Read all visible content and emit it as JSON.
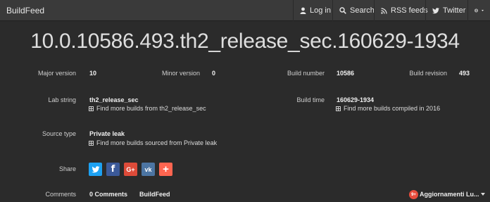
{
  "navbar": {
    "brand": "BuildFeed",
    "login": "Log in",
    "search": "Search",
    "rss": "RSS feeds",
    "twitter": "Twitter"
  },
  "build": {
    "title": "10.0.10586.493.th2_release_sec.160629-1934",
    "major_label": "Major version",
    "major_value": "10",
    "minor_label": "Minor version",
    "minor_value": "0",
    "number_label": "Build number",
    "number_value": "10586",
    "revision_label": "Build revision",
    "revision_value": "493",
    "lab_label": "Lab string",
    "lab_value": "th2_release_sec",
    "lab_link": "Find more builds from th2_release_sec",
    "time_label": "Build time",
    "time_value": "160629-1934",
    "time_link": "Find more builds compiled in 2016",
    "source_label": "Source type",
    "source_value": "Private leak",
    "source_link": "Find more builds sourced from Private leak",
    "share_label": "Share",
    "comments_label": "Comments",
    "comments_count": "0 Comments",
    "comments_site": "BuildFeed",
    "aggregator": "Aggiornamenti Lu..."
  },
  "share_buttons": [
    {
      "name": "twitter-share-button",
      "glyph": "t",
      "color": "#1da1f2"
    },
    {
      "name": "facebook-share-button",
      "glyph": "f",
      "color": "#3b5998"
    },
    {
      "name": "googleplus-share-button",
      "glyph": "G+",
      "color": "#dd4b39"
    },
    {
      "name": "vk-share-button",
      "glyph": "vk",
      "color": "#4c75a3"
    },
    {
      "name": "more-share-button",
      "glyph": "+",
      "color": "#ff6550"
    }
  ],
  "colors": {
    "background": "#2b2b2b",
    "navbar": "#3a3a3a",
    "badge": "#e74c3c"
  }
}
